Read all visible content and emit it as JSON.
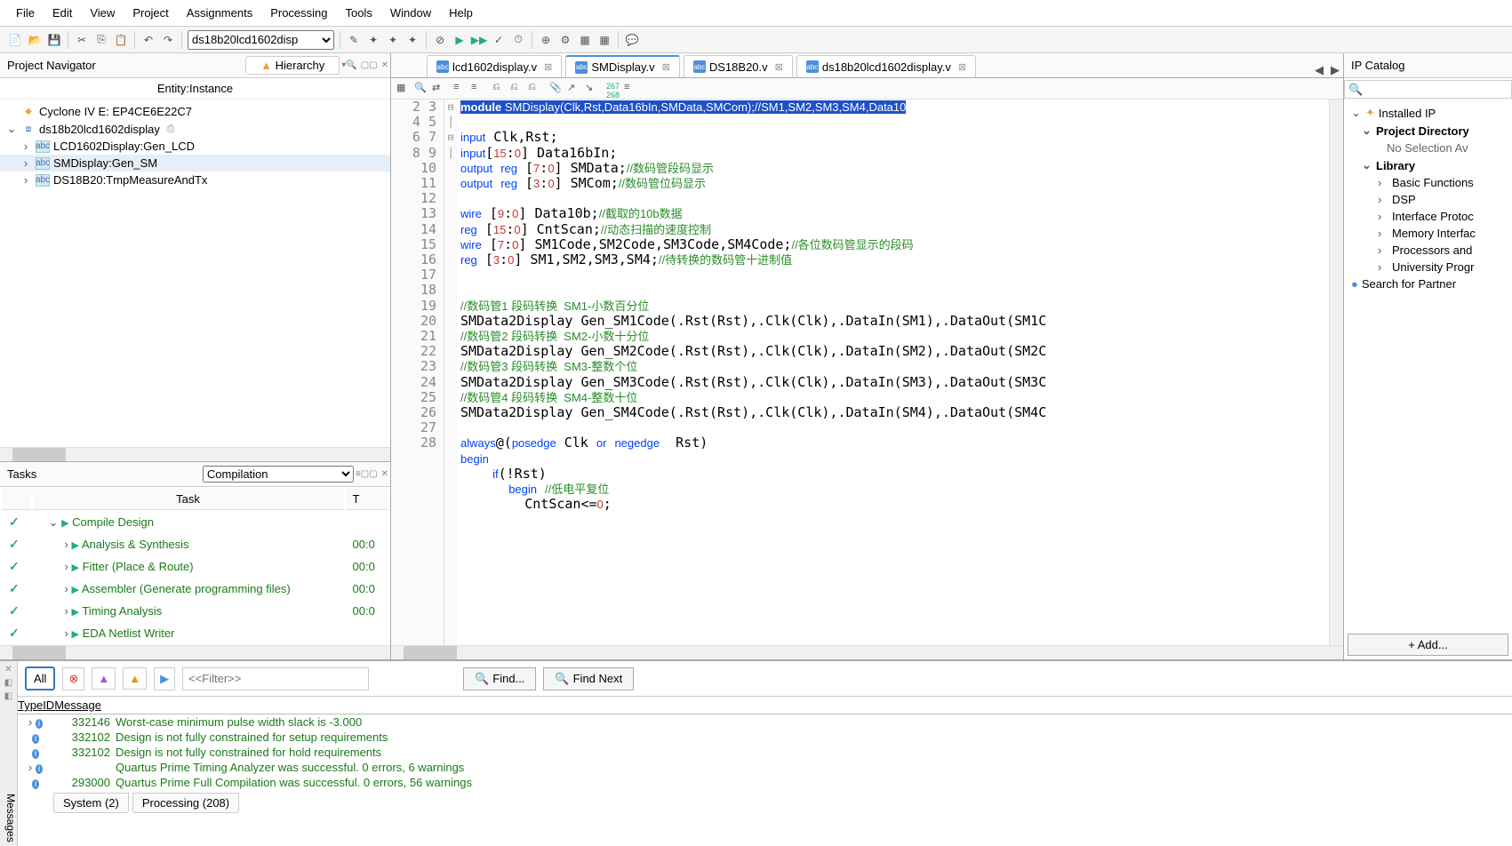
{
  "menu": {
    "file": "File",
    "edit": "Edit",
    "view": "View",
    "project": "Project",
    "assignments": "Assignments",
    "processing": "Processing",
    "tools": "Tools",
    "window": "Window",
    "help": "Help"
  },
  "toolbar": {
    "project_select": "ds18b20lcd1602disp"
  },
  "nav": {
    "title": "Project Navigator",
    "tab_hierarchy": "Hierarchy",
    "entity_hdr": "Entity:Instance",
    "device": "Cyclone IV E: EP4CE6E22C7",
    "root": "ds18b20lcd1602display",
    "children": [
      "LCD1602Display:Gen_LCD",
      "SMDisplay:Gen_SM",
      "DS18B20:TmpMeasureAndTx"
    ]
  },
  "tasks": {
    "title": "Tasks",
    "mode": "Compilation",
    "col_task": "Task",
    "col_t": "T",
    "rows": [
      {
        "name": "Compile Design",
        "time": "",
        "indent": 0,
        "exp": "⌄"
      },
      {
        "name": "Analysis & Synthesis",
        "time": "00:0",
        "indent": 1,
        "exp": "›"
      },
      {
        "name": "Fitter (Place & Route)",
        "time": "00:0",
        "indent": 1,
        "exp": "›"
      },
      {
        "name": "Assembler (Generate programming files)",
        "time": "00:0",
        "indent": 1,
        "exp": "›"
      },
      {
        "name": "Timing Analysis",
        "time": "00:0",
        "indent": 1,
        "exp": "›"
      },
      {
        "name": "EDA Netlist Writer",
        "time": "",
        "indent": 1,
        "exp": "›"
      }
    ]
  },
  "editor": {
    "tabs": [
      {
        "name": "lcd1602display.v",
        "active": false
      },
      {
        "name": "SMDisplay.v",
        "active": true
      },
      {
        "name": "DS18B20.v",
        "active": false
      },
      {
        "name": "ds18b20lcd1602display.v",
        "active": false
      }
    ],
    "line_start": 2,
    "line_end": 28
  },
  "ip": {
    "title": "IP Catalog",
    "installed": "Installed IP",
    "projdir": "Project Directory",
    "nosel": "No Selection Av",
    "library": "Library",
    "items": [
      "Basic Functions",
      "DSP",
      "Interface Protoc",
      "Memory Interfac",
      "Processors and ",
      "University Progr"
    ],
    "search": "Search for Partner",
    "add": "+  Add..."
  },
  "messages": {
    "all": "All",
    "filter_ph": "<<Filter>>",
    "find": "Find...",
    "findnext": "Find Next",
    "hdr_type": "Type",
    "hdr_id": "ID",
    "hdr_msg": "Message",
    "rows": [
      {
        "icon": "i",
        "id": "332146",
        "text": "Worst-case minimum pulse width slack is -3.000",
        "pre": "›"
      },
      {
        "icon": "i",
        "id": "332102",
        "text": "Design is not fully constrained for setup requirements",
        "pre": ""
      },
      {
        "icon": "i",
        "id": "332102",
        "text": "Design is not fully constrained for hold requirements",
        "pre": ""
      },
      {
        "icon": "i",
        "id": "",
        "text": "Quartus Prime Timing Analyzer was successful. 0 errors, 6 warnings",
        "pre": "›"
      },
      {
        "icon": "i",
        "id": "293000",
        "text": "Quartus Prime Full Compilation was successful. 0 errors, 56 warnings",
        "pre": ""
      }
    ],
    "side": "Messages",
    "tab_system": "System (2)",
    "tab_processing": "Processing (208)"
  }
}
